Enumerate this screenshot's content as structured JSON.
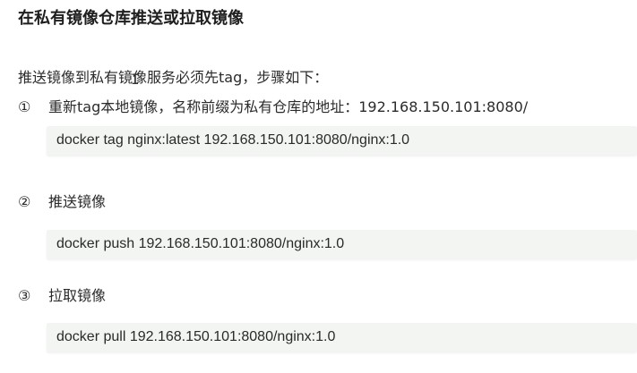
{
  "document": {
    "title": "在私有镜像仓库推送或拉取镜像",
    "intro": "推送镜像到私有镜像服务必须先tag，步骤如下：",
    "cursor_glyph": "I",
    "steps": [
      {
        "number": "①",
        "text": "重新tag本地镜像，名称前缀为私有仓库的地址：192.168.150.101:8080/",
        "code": "docker tag nginx:latest 192.168.150.101:8080/nginx:1.0"
      },
      {
        "number": "②",
        "text": "推送镜像",
        "code": "docker push 192.168.150.101:8080/nginx:1.0"
      },
      {
        "number": "③",
        "text": "拉取镜像",
        "code": "docker pull 192.168.150.101:8080/nginx:1.0"
      }
    ]
  },
  "colors": {
    "code_background": "#f2f5f2",
    "text": "#2b2b2b"
  }
}
